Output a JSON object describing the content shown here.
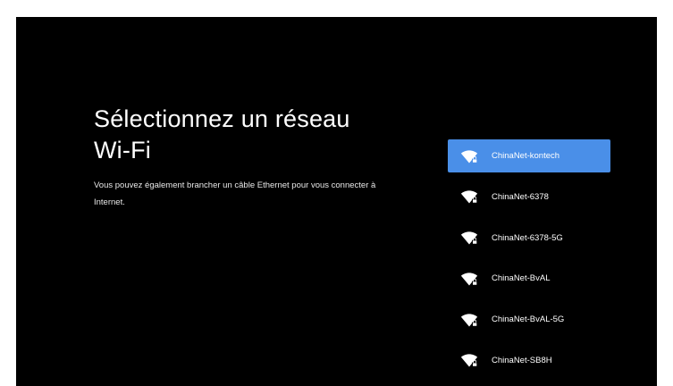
{
  "page": {
    "title": "Sélectionnez un réseau Wi-Fi",
    "subtitle": "Vous pouvez également brancher un câble Ethernet pour vous connecter à Internet."
  },
  "colors": {
    "background": "#000000",
    "selected": "#4a8fe8",
    "text": "#ffffff"
  },
  "networks": [
    {
      "label": "ChinaNet-kontech",
      "icon": "wifi-lock-icon",
      "selected": true
    },
    {
      "label": "ChinaNet-6378",
      "icon": "wifi-lock-icon",
      "selected": false
    },
    {
      "label": "ChinaNet-6378-5G",
      "icon": "wifi-lock-icon",
      "selected": false
    },
    {
      "label": "ChinaNet-BvAL",
      "icon": "wifi-lock-icon",
      "selected": false
    },
    {
      "label": "ChinaNet-BvAL-5G",
      "icon": "wifi-lock-icon",
      "selected": false
    },
    {
      "label": "ChinaNet-SB8H",
      "icon": "wifi-lock-icon",
      "selected": false
    }
  ]
}
